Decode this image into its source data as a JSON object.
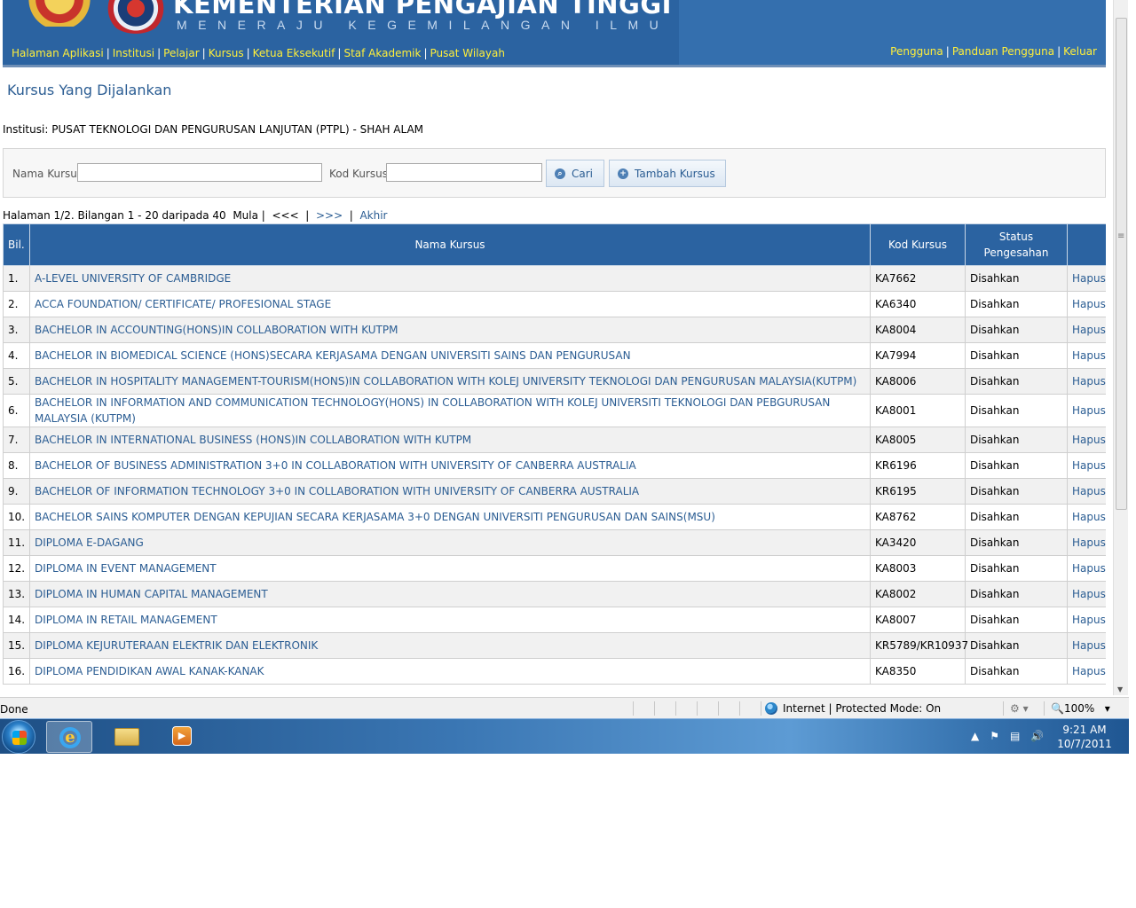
{
  "header": {
    "ministry_title": "KEMENTERIAN PENGAJIAN TINGGI",
    "motto": "MENERAJU KEGEMILANGAN ILMU",
    "nav_left": [
      "Halaman Aplikasi",
      "Institusi",
      "Pelajar",
      "Kursus",
      "Ketua Eksekutif",
      "Staf Akademik",
      "Pusat Wilayah"
    ],
    "nav_right": [
      "Pengguna",
      "Panduan Pengguna",
      "Keluar"
    ],
    "separator": "|",
    "colors": {
      "header_bg": "#2b63a1",
      "nav_link": "#ffef3a"
    }
  },
  "page": {
    "title": "Kursus Yang Dijalankan",
    "institution_label": "Institusi:",
    "institution_name": "PUSAT TEKNOLOGI DAN PENGURUSAN LANJUTAN (PTPL) - SHAH ALAM"
  },
  "search": {
    "course_name_label": "Nama Kursus",
    "course_name_value": "",
    "course_code_label": "Kod Kursus",
    "course_code_value": "",
    "search_button": "Cari",
    "search_icon": "search-icon",
    "add_button": "Tambah Kursus",
    "add_icon": "plus-circle-icon"
  },
  "pagination": {
    "summary": "Halaman 1/2. Bilangan 1 - 20 daripada 40",
    "first": "Mula",
    "prev": "<<<",
    "next": ">>>",
    "last": "Akhir"
  },
  "table": {
    "headers": {
      "no": "Bil.",
      "name": "Nama Kursus",
      "code": "Kod Kursus",
      "status": "Status Pengesahan",
      "action": ""
    },
    "rows": [
      {
        "no": "1.",
        "name": "A-LEVEL UNIVERSITY OF CAMBRIDGE",
        "code": "KA7662",
        "status": "Disahkan",
        "action": "Hapus"
      },
      {
        "no": "2.",
        "name": "ACCA FOUNDATION/ CERTIFICATE/ PROFESIONAL STAGE",
        "code": "KA6340",
        "status": "Disahkan",
        "action": "Hapus"
      },
      {
        "no": "3.",
        "name": "BACHELOR IN ACCOUNTING(HONS)IN COLLABORATION WITH KUTPM",
        "code": "KA8004",
        "status": "Disahkan",
        "action": "Hapus"
      },
      {
        "no": "4.",
        "name": "BACHELOR IN BIOMEDICAL SCIENCE (HONS)SECARA KERJASAMA DENGAN UNIVERSITI SAINS DAN PENGURUSAN",
        "code": "KA7994",
        "status": "Disahkan",
        "action": "Hapus"
      },
      {
        "no": "5.",
        "name": "BACHELOR IN HOSPITALITY MANAGEMENT-TOURISM(HONS)IN COLLABORATION WITH KOLEJ UNIVERSITY TEKNOLOGI DAN PENGURUSAN MALAYSIA(KUTPM)",
        "code": "KA8006",
        "status": "Disahkan",
        "action": "Hapus"
      },
      {
        "no": "6.",
        "name": "BACHELOR IN INFORMATION AND COMMUNICATION TECHNOLOGY(HONS) IN COLLABORATION WITH KOLEJ UNIVERSITI TEKNOLOGI DAN PEBGURUSAN MALAYSIA (KUTPM)",
        "code": "KA8001",
        "status": "Disahkan",
        "action": "Hapus"
      },
      {
        "no": "7.",
        "name": "BACHELOR IN INTERNATIONAL BUSINESS (HONS)IN COLLABORATION WITH KUTPM",
        "code": "KA8005",
        "status": "Disahkan",
        "action": "Hapus"
      },
      {
        "no": "8.",
        "name": "BACHELOR OF BUSINESS ADMINISTRATION 3+0 IN COLLABORATION WITH UNIVERSITY OF CANBERRA AUSTRALIA",
        "code": "KR6196",
        "status": "Disahkan",
        "action": "Hapus"
      },
      {
        "no": "9.",
        "name": "BACHELOR OF INFORMATION TECHNOLOGY 3+0 IN COLLABORATION WITH UNIVERSITY OF CANBERRA AUSTRALIA",
        "code": "KR6195",
        "status": "Disahkan",
        "action": "Hapus"
      },
      {
        "no": "10.",
        "name": "BACHELOR SAINS KOMPUTER DENGAN KEPUJIAN SECARA KERJASAMA 3+0 DENGAN UNIVERSITI PENGURUSAN DAN SAINS(MSU)",
        "code": "KA8762",
        "status": "Disahkan",
        "action": "Hapus"
      },
      {
        "no": "11.",
        "name": "DIPLOMA E-DAGANG",
        "code": "KA3420",
        "status": "Disahkan",
        "action": "Hapus"
      },
      {
        "no": "12.",
        "name": "DIPLOMA IN EVENT MANAGEMENT",
        "code": "KA8003",
        "status": "Disahkan",
        "action": "Hapus"
      },
      {
        "no": "13.",
        "name": "DIPLOMA IN HUMAN CAPITAL MANAGEMENT",
        "code": "KA8002",
        "status": "Disahkan",
        "action": "Hapus"
      },
      {
        "no": "14.",
        "name": "DIPLOMA IN RETAIL MANAGEMENT",
        "code": "KA8007",
        "status": "Disahkan",
        "action": "Hapus"
      },
      {
        "no": "15.",
        "name": "DIPLOMA KEJURUTERAAN ELEKTRIK DAN ELEKTRONIK",
        "code": "KR5789/KR10937",
        "status": "Disahkan",
        "action": "Hapus"
      },
      {
        "no": "16.",
        "name": "DIPLOMA PENDIDIKAN AWAL KANAK-KANAK",
        "code": "KA8350",
        "status": "Disahkan",
        "action": "Hapus"
      }
    ]
  },
  "browser": {
    "status_text": "Done",
    "zone": "Internet | Protected Mode: On",
    "zoom": "100%"
  },
  "taskbar": {
    "time": "9:21 AM",
    "date": "10/7/2011",
    "apps": [
      "internet-explorer-icon",
      "windows-explorer-icon",
      "media-player-icon"
    ]
  }
}
